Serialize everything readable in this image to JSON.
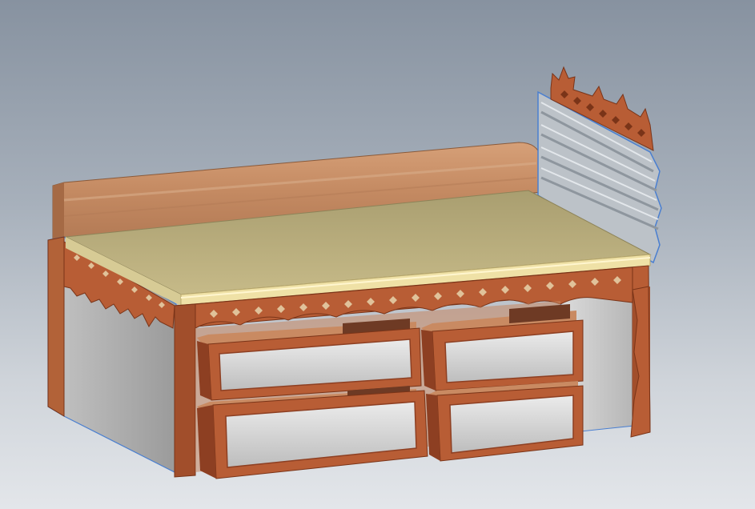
{
  "viewport": {
    "background_top": "#8792a0",
    "background_bottom": "#e3e6ea"
  },
  "model": {
    "kind": "3d-cad-model",
    "object": "captain-bed-with-drawers",
    "drawer_count": 4,
    "colors": {
      "wood": "#b85d35",
      "wood_dark": "#8d3f22",
      "backboard": "#c9926a",
      "mattress_top": "#b9ad7c",
      "mattress_edge": "#efe1a6",
      "panel_gray": "#c9c9c9",
      "headboard_gray": "#bcc2c8",
      "selection_outline": "#4a7fd0"
    }
  }
}
